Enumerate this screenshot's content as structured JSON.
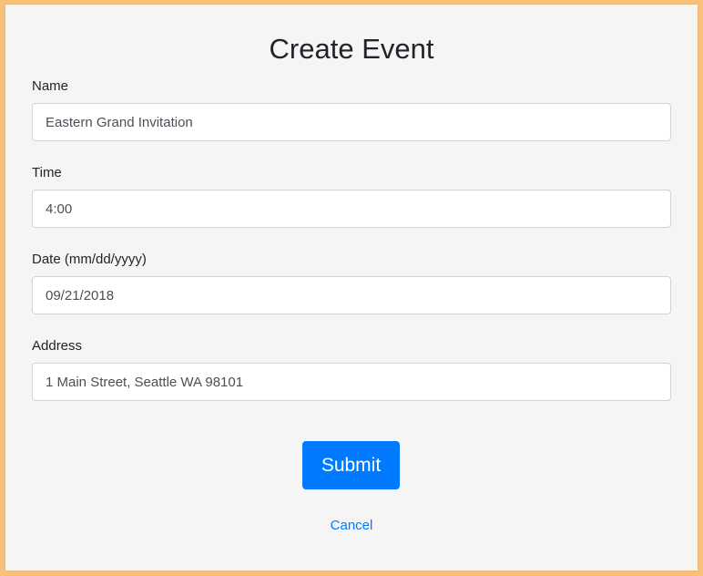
{
  "form": {
    "title": "Create Event",
    "fields": [
      {
        "label": "Name",
        "value": "Eastern Grand Invitation"
      },
      {
        "label": "Time",
        "value": "4:00"
      },
      {
        "label": "Date (mm/dd/yyyy)",
        "value": "09/21/2018"
      },
      {
        "label": "Address",
        "value": "1 Main Street, Seattle WA 98101"
      }
    ],
    "submit_label": "Submit",
    "cancel_label": "Cancel"
  },
  "colors": {
    "page_background": "#f7c179",
    "card_background": "#f5f5f5",
    "primary": "#007bff"
  }
}
